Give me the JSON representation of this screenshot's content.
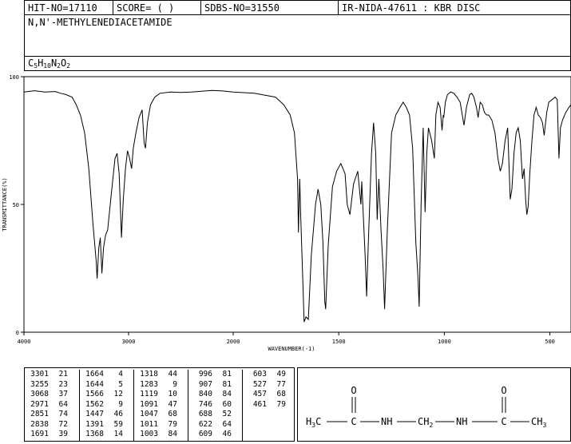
{
  "header": {
    "hit_no": "HIT-NO=17110",
    "score": "SCORE=  (   )",
    "sdbs_no": "SDBS-NO=31550",
    "ir_info": "IR-NIDA-47611 : KBR DISC"
  },
  "compound": {
    "name": "N,N'-METHYLENEDIACETAMIDE",
    "formula_parts": [
      "C",
      "5",
      "H",
      "10",
      "N",
      "2",
      "O",
      "2"
    ]
  },
  "chart_data": {
    "type": "line",
    "xlabel": "WAVENUMBER(-1)",
    "ylabel": "TRANSMITTANCE(%)",
    "xlim": [
      4000,
      400
    ],
    "ylim": [
      0,
      100
    ],
    "x_ticks": [
      4000,
      3000,
      2000,
      1500,
      1000,
      500
    ],
    "y_ticks": [
      0,
      50,
      100
    ],
    "series": [
      {
        "points": [
          [
            4000,
            94
          ],
          [
            3900,
            94.5
          ],
          [
            3800,
            94
          ],
          [
            3700,
            94.2
          ],
          [
            3650,
            93.5
          ],
          [
            3600,
            93
          ],
          [
            3540,
            92
          ],
          [
            3500,
            89
          ],
          [
            3460,
            85
          ],
          [
            3420,
            78
          ],
          [
            3380,
            64
          ],
          [
            3340,
            42
          ],
          [
            3310,
            28
          ],
          [
            3301,
            21
          ],
          [
            3285,
            33
          ],
          [
            3270,
            37
          ],
          [
            3255,
            23
          ],
          [
            3240,
            33
          ],
          [
            3220,
            38
          ],
          [
            3200,
            40
          ],
          [
            3170,
            52
          ],
          [
            3130,
            68
          ],
          [
            3110,
            70
          ],
          [
            3090,
            62
          ],
          [
            3068,
            37
          ],
          [
            3050,
            52
          ],
          [
            3030,
            64
          ],
          [
            3010,
            71
          ],
          [
            2990,
            68
          ],
          [
            2971,
            64
          ],
          [
            2955,
            72
          ],
          [
            2930,
            78
          ],
          [
            2900,
            84
          ],
          [
            2870,
            87
          ],
          [
            2851,
            74
          ],
          [
            2838,
            72
          ],
          [
            2820,
            82
          ],
          [
            2790,
            89
          ],
          [
            2750,
            92
          ],
          [
            2700,
            93.5
          ],
          [
            2600,
            94
          ],
          [
            2500,
            93.8
          ],
          [
            2400,
            94
          ],
          [
            2300,
            94.3
          ],
          [
            2200,
            94.6
          ],
          [
            2100,
            94.4
          ],
          [
            2000,
            94
          ],
          [
            1900,
            93.5
          ],
          [
            1800,
            92
          ],
          [
            1760,
            89
          ],
          [
            1730,
            85
          ],
          [
            1710,
            78
          ],
          [
            1695,
            60
          ],
          [
            1691,
            39
          ],
          [
            1685,
            60
          ],
          [
            1680,
            45
          ],
          [
            1670,
            20
          ],
          [
            1664,
            4
          ],
          [
            1655,
            6
          ],
          [
            1644,
            5
          ],
          [
            1630,
            30
          ],
          [
            1610,
            50
          ],
          [
            1598,
            56
          ],
          [
            1585,
            50
          ],
          [
            1575,
            35
          ],
          [
            1566,
            12
          ],
          [
            1562,
            9
          ],
          [
            1550,
            34
          ],
          [
            1530,
            57
          ],
          [
            1510,
            63
          ],
          [
            1490,
            66
          ],
          [
            1470,
            62
          ],
          [
            1460,
            50
          ],
          [
            1447,
            46
          ],
          [
            1430,
            58
          ],
          [
            1410,
            63
          ],
          [
            1395,
            50
          ],
          [
            1391,
            59
          ],
          [
            1385,
            48
          ],
          [
            1375,
            30
          ],
          [
            1368,
            14
          ],
          [
            1360,
            35
          ],
          [
            1345,
            70
          ],
          [
            1335,
            82
          ],
          [
            1325,
            70
          ],
          [
            1318,
            44
          ],
          [
            1310,
            60
          ],
          [
            1300,
            40
          ],
          [
            1290,
            25
          ],
          [
            1283,
            9
          ],
          [
            1270,
            40
          ],
          [
            1250,
            78
          ],
          [
            1230,
            85
          ],
          [
            1210,
            88
          ],
          [
            1195,
            90
          ],
          [
            1180,
            88
          ],
          [
            1165,
            85
          ],
          [
            1150,
            72
          ],
          [
            1135,
            35
          ],
          [
            1125,
            22
          ],
          [
            1119,
            10
          ],
          [
            1110,
            50
          ],
          [
            1100,
            80
          ],
          [
            1091,
            47
          ],
          [
            1083,
            70
          ],
          [
            1075,
            80
          ],
          [
            1060,
            75
          ],
          [
            1047,
            68
          ],
          [
            1040,
            85
          ],
          [
            1030,
            90
          ],
          [
            1020,
            88
          ],
          [
            1011,
            79
          ],
          [
            1005,
            85
          ],
          [
            1003,
            84
          ],
          [
            995,
            90
          ],
          [
            985,
            93
          ],
          [
            970,
            94
          ],
          [
            955,
            93.5
          ],
          [
            940,
            92
          ],
          [
            925,
            90
          ],
          [
            907,
            81
          ],
          [
            895,
            88
          ],
          [
            880,
            93
          ],
          [
            870,
            93.5
          ],
          [
            860,
            92
          ],
          [
            848,
            88
          ],
          [
            840,
            84
          ],
          [
            830,
            90
          ],
          [
            820,
            89
          ],
          [
            810,
            86
          ],
          [
            800,
            85
          ],
          [
            790,
            85
          ],
          [
            775,
            83
          ],
          [
            760,
            78
          ],
          [
            746,
            68
          ],
          [
            735,
            63
          ],
          [
            725,
            66
          ],
          [
            712,
            75
          ],
          [
            700,
            80
          ],
          [
            688,
            52
          ],
          [
            680,
            56
          ],
          [
            670,
            70
          ],
          [
            660,
            78
          ],
          [
            650,
            80
          ],
          [
            640,
            75
          ],
          [
            630,
            60
          ],
          [
            622,
            64
          ],
          [
            615,
            52
          ],
          [
            609,
            46
          ],
          [
            603,
            49
          ],
          [
            595,
            62
          ],
          [
            585,
            75
          ],
          [
            575,
            85
          ],
          [
            565,
            88
          ],
          [
            555,
            85
          ],
          [
            545,
            84
          ],
          [
            535,
            82
          ],
          [
            527,
            77
          ],
          [
            515,
            86
          ],
          [
            505,
            90
          ],
          [
            490,
            91
          ],
          [
            475,
            92
          ],
          [
            465,
            91
          ],
          [
            461,
            79
          ],
          [
            457,
            68
          ],
          [
            450,
            80
          ],
          [
            440,
            83
          ],
          [
            425,
            86
          ],
          [
            410,
            88
          ],
          [
            400,
            89
          ]
        ]
      }
    ],
    "peak_table": [
      [
        [
          3301,
          21
        ],
        [
          3255,
          23
        ],
        [
          3068,
          37
        ],
        [
          2971,
          64
        ],
        [
          2851,
          74
        ],
        [
          2838,
          72
        ],
        [
          1691,
          39
        ]
      ],
      [
        [
          1664,
          4
        ],
        [
          1644,
          5
        ],
        [
          1566,
          12
        ],
        [
          1562,
          9
        ],
        [
          1447,
          46
        ],
        [
          1391,
          59
        ],
        [
          1368,
          14
        ]
      ],
      [
        [
          1318,
          44
        ],
        [
          1283,
          9
        ],
        [
          1119,
          10
        ],
        [
          1091,
          47
        ],
        [
          1047,
          68
        ],
        [
          1011,
          79
        ],
        [
          1003,
          84
        ]
      ],
      [
        [
          996,
          81
        ],
        [
          907,
          81
        ],
        [
          840,
          84
        ],
        [
          746,
          60
        ],
        [
          688,
          52
        ],
        [
          622,
          64
        ],
        [
          609,
          46
        ]
      ],
      [
        [
          603,
          49
        ],
        [
          527,
          77
        ],
        [
          457,
          68
        ],
        [
          461,
          79
        ]
      ]
    ]
  },
  "structure": {
    "o_label": "O",
    "h3c": "H",
    "h3c_sub": "3",
    "c1": "C",
    "c2": "C",
    "nh1": "NH",
    "ch2": "CH",
    "ch2_sub": "2",
    "nh2": "NH",
    "ch3": "CH",
    "ch3_sub": "3"
  }
}
